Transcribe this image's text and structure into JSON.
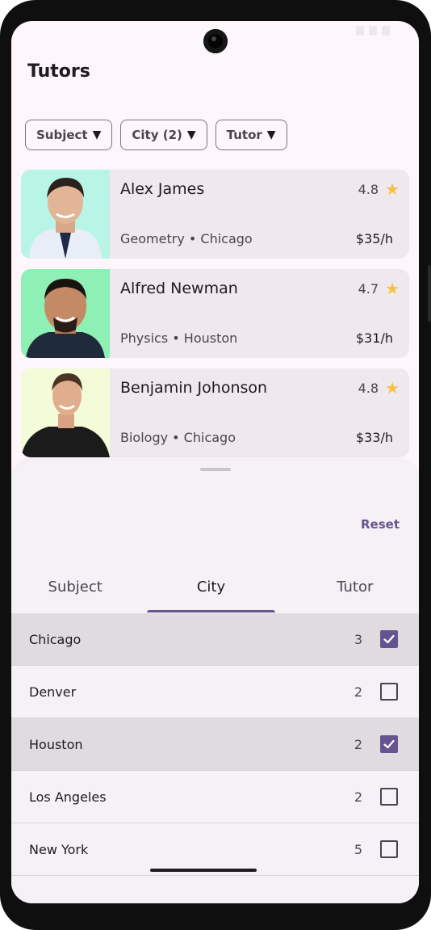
{
  "app": {
    "title": "Tutors"
  },
  "filters": {
    "chips": [
      {
        "label": "Subject",
        "caret": "▼"
      },
      {
        "label": "City (2)",
        "caret": "▼"
      },
      {
        "label": "Tutor",
        "caret": "▼"
      }
    ]
  },
  "tutors": [
    {
      "name": "Alex James",
      "rating": "4.8",
      "subject_city": "Geometry • Chicago",
      "price": "$35/h",
      "photo_bg": "#b9f5e6"
    },
    {
      "name": "Alfred Newman",
      "rating": "4.7",
      "subject_city": "Physics • Houston",
      "price": "$31/h",
      "photo_bg": "#8ef0b4"
    },
    {
      "name": "Benjamin Johonson",
      "rating": "4.8",
      "subject_city": "Biology • Chicago",
      "price": "$33/h",
      "photo_bg": "#f3fbd9"
    }
  ],
  "rating_icon": "star-icon",
  "sheet": {
    "reset_label": "Reset",
    "tabs": [
      {
        "label": "Subject",
        "active": false
      },
      {
        "label": "City",
        "active": true
      },
      {
        "label": "Tutor",
        "active": false
      }
    ],
    "cities": [
      {
        "name": "Chicago",
        "count": "3",
        "checked": true
      },
      {
        "name": "Denver",
        "count": "2",
        "checked": false
      },
      {
        "name": "Houston",
        "count": "2",
        "checked": true
      },
      {
        "name": "Los Angeles",
        "count": "2",
        "checked": false
      },
      {
        "name": "New York",
        "count": "5",
        "checked": false
      }
    ]
  },
  "colors": {
    "accent": "#65558f",
    "star": "#f6c141",
    "card_bg": "#efe9ee",
    "sheet_bg": "#f6f1f6"
  }
}
